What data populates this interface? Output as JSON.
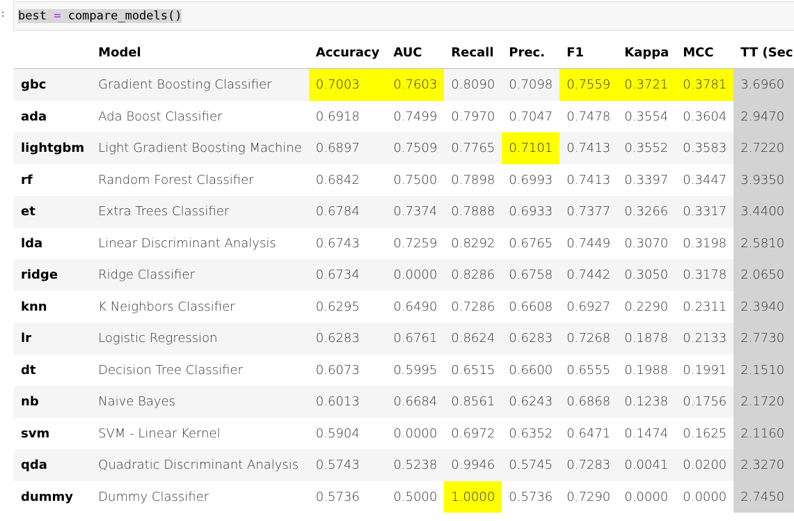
{
  "cell": {
    "prompt": ":",
    "code_var": "best",
    "code_op": "=",
    "code_call": "compare_models()"
  },
  "table": {
    "columns": [
      "",
      "Model",
      "Accuracy",
      "AUC",
      "Recall",
      "Prec.",
      "F1",
      "Kappa",
      "MCC",
      "TT (Sec)"
    ],
    "rows": [
      [
        "gbc",
        "Gradient Boosting Classifier",
        "0.7003",
        "0.7603",
        "0.8090",
        "0.7098",
        "0.7559",
        "0.3721",
        "0.3781",
        "3.6960"
      ],
      [
        "ada",
        "Ada Boost Classifier",
        "0.6918",
        "0.7499",
        "0.7970",
        "0.7047",
        "0.7478",
        "0.3554",
        "0.3604",
        "2.9470"
      ],
      [
        "lightgbm",
        "Light Gradient Boosting Machine",
        "0.6897",
        "0.7509",
        "0.7765",
        "0.7101",
        "0.7413",
        "0.3552",
        "0.3583",
        "2.7220"
      ],
      [
        "rf",
        "Random Forest Classifier",
        "0.6842",
        "0.7500",
        "0.7898",
        "0.6993",
        "0.7413",
        "0.3397",
        "0.3447",
        "3.9350"
      ],
      [
        "et",
        "Extra Trees Classifier",
        "0.6784",
        "0.7374",
        "0.7888",
        "0.6933",
        "0.7377",
        "0.3266",
        "0.3317",
        "3.4400"
      ],
      [
        "lda",
        "Linear Discriminant Analysis",
        "0.6743",
        "0.7259",
        "0.8292",
        "0.6765",
        "0.7449",
        "0.3070",
        "0.3198",
        "2.5810"
      ],
      [
        "ridge",
        "Ridge Classifier",
        "0.6734",
        "0.0000",
        "0.8286",
        "0.6758",
        "0.7442",
        "0.3050",
        "0.3178",
        "2.0650"
      ],
      [
        "knn",
        "K Neighbors Classifier",
        "0.6295",
        "0.6490",
        "0.7286",
        "0.6608",
        "0.6927",
        "0.2290",
        "0.2311",
        "2.3940"
      ],
      [
        "lr",
        "Logistic Regression",
        "0.6283",
        "0.6761",
        "0.8624",
        "0.6283",
        "0.7268",
        "0.1878",
        "0.2133",
        "2.7730"
      ],
      [
        "dt",
        "Decision Tree Classifier",
        "0.6073",
        "0.5995",
        "0.6515",
        "0.6600",
        "0.6555",
        "0.1988",
        "0.1991",
        "2.1510"
      ],
      [
        "nb",
        "Naive Bayes",
        "0.6013",
        "0.6684",
        "0.8561",
        "0.6243",
        "0.6868",
        "0.1238",
        "0.1756",
        "2.1720"
      ],
      [
        "svm",
        "SVM - Linear Kernel",
        "0.5904",
        "0.0000",
        "0.6972",
        "0.6352",
        "0.6471",
        "0.1474",
        "0.1625",
        "2.1160"
      ],
      [
        "qda",
        "Quadratic Discriminant Analysis",
        "0.5743",
        "0.5238",
        "0.9946",
        "0.5745",
        "0.7283",
        "0.0041",
        "0.0200",
        "2.3270"
      ],
      [
        "dummy",
        "Dummy Classifier",
        "0.5736",
        "0.5000",
        "1.0000",
        "0.5736",
        "0.7290",
        "0.0000",
        "0.0000",
        "2.7450"
      ]
    ],
    "highlights": [
      [
        0,
        2
      ],
      [
        0,
        3
      ],
      [
        0,
        6
      ],
      [
        0,
        7
      ],
      [
        0,
        8
      ],
      [
        2,
        5
      ],
      [
        13,
        4
      ]
    ],
    "highlight_color": "#ffff00",
    "tt_column_color": "#d3d3d3"
  }
}
